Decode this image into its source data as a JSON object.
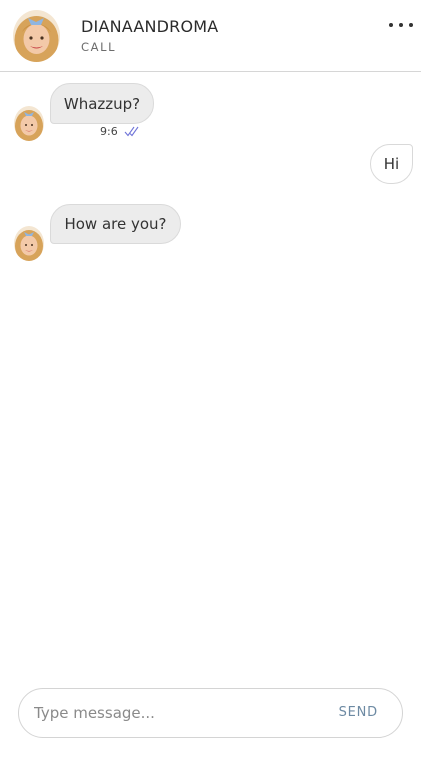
{
  "header": {
    "name": "DIANAANDROMA",
    "status": "CALL"
  },
  "messages": [
    {
      "direction": "in",
      "text": "Whazzup?",
      "time": "9:6",
      "read_icon": "double-check-icon"
    },
    {
      "direction": "out",
      "text": "Hi"
    },
    {
      "direction": "in",
      "text": "How are you?"
    }
  ],
  "composer": {
    "placeholder": "Type message...",
    "send_label": "SEND"
  },
  "colors": {
    "incoming_bubble": "#ececec",
    "outgoing_bubble": "#ffffff",
    "send_text": "#6d8aa3",
    "read_ticks": "#6f74d8"
  }
}
